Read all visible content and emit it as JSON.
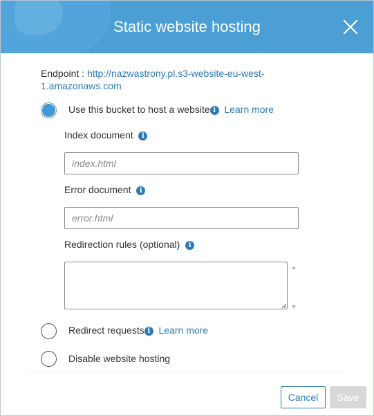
{
  "dialog": {
    "title": "Static website hosting",
    "endpoint_label": "Endpoint :",
    "endpoint_url": "http://nazwastrony.pl.s3-website-eu-west-1.amazonaws.com"
  },
  "options": {
    "host": {
      "label": "Use this bucket to host a website",
      "learn_more": "Learn more",
      "selected": true
    },
    "redirect": {
      "label": "Redirect requests",
      "learn_more": "Learn more",
      "selected": false
    },
    "disable": {
      "label": "Disable website hosting",
      "selected": false
    }
  },
  "fields": {
    "index_document": {
      "label": "Index document",
      "placeholder": "index.html",
      "value": ""
    },
    "error_document": {
      "label": "Error document",
      "placeholder": "error.html",
      "value": ""
    },
    "redirection_rules": {
      "label": "Redirection rules (optional)",
      "value": ""
    }
  },
  "footer": {
    "cancel_label": "Cancel",
    "save_label": "Save"
  },
  "colors": {
    "header": "#4b9fd5",
    "link": "#2e7ab8",
    "radio_selected": "#3f9ad8",
    "save_disabled": "#d8d8d8"
  },
  "icons": {
    "close": "close-icon",
    "info": "info-icon"
  }
}
